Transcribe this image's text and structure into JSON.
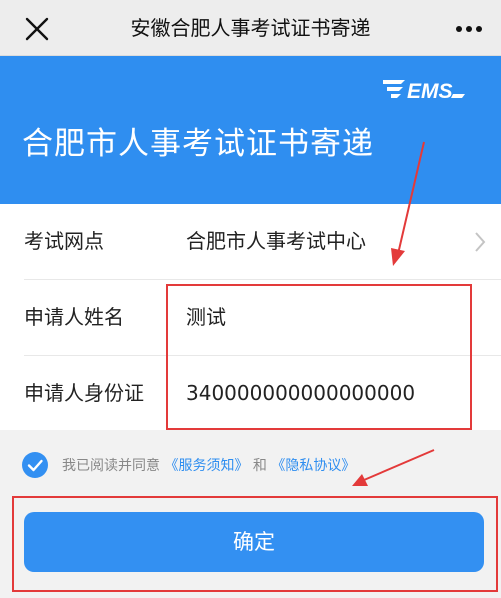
{
  "titlebar": {
    "title": "安徽合肥人事考试证书寄递",
    "close_icon": "close-icon",
    "more_icon": "more-dots-icon"
  },
  "banner": {
    "logo_text": "EMS",
    "title": "合肥市人事考试证书寄递",
    "color": "#2f8ef0"
  },
  "form": {
    "rows": [
      {
        "label": "考试网点",
        "value": "合肥市人事考试中心"
      },
      {
        "label": "申请人姓名",
        "value": "测试"
      },
      {
        "label": "申请人身份证",
        "value": "340000000000000000"
      }
    ]
  },
  "agreement": {
    "prefix": "我已阅读并同意",
    "service_link": "《服务须知》",
    "and_text": "和",
    "privacy_link": "《隐私协议》",
    "checked": true
  },
  "confirm": {
    "label": "确定"
  },
  "colors": {
    "accent": "#3390f2",
    "annotation": "#e33a3a"
  }
}
